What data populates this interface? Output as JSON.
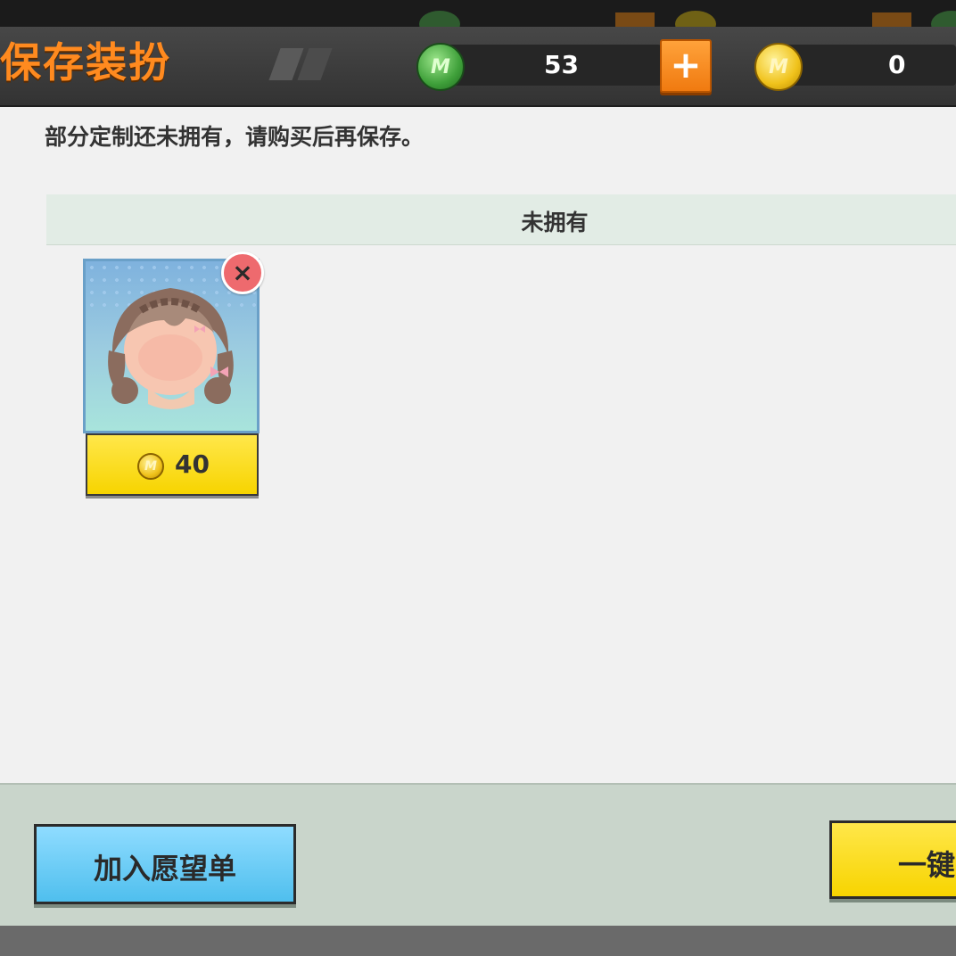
{
  "header": {
    "title": "保存装扮",
    "gems": "53",
    "coins": "0",
    "plus_label": "+",
    "gem_icon_text": "M",
    "coin_icon_text": "M"
  },
  "panel": {
    "message": "部分定制还未拥有，请购买后再保存。",
    "section_title": "未拥有",
    "items": [
      {
        "name": "braided-pigtails-hair",
        "price": "40",
        "remove_label": "×"
      }
    ]
  },
  "footer": {
    "wishlist_label": "加入愿望单",
    "buy_all_label": "一键"
  },
  "colors": {
    "title": "#ff8a1f",
    "plus_button": "#f07a10",
    "price_button": "#f7d400",
    "wishlist_button": "#4fbfee",
    "remove_button": "#ee6a6e"
  }
}
